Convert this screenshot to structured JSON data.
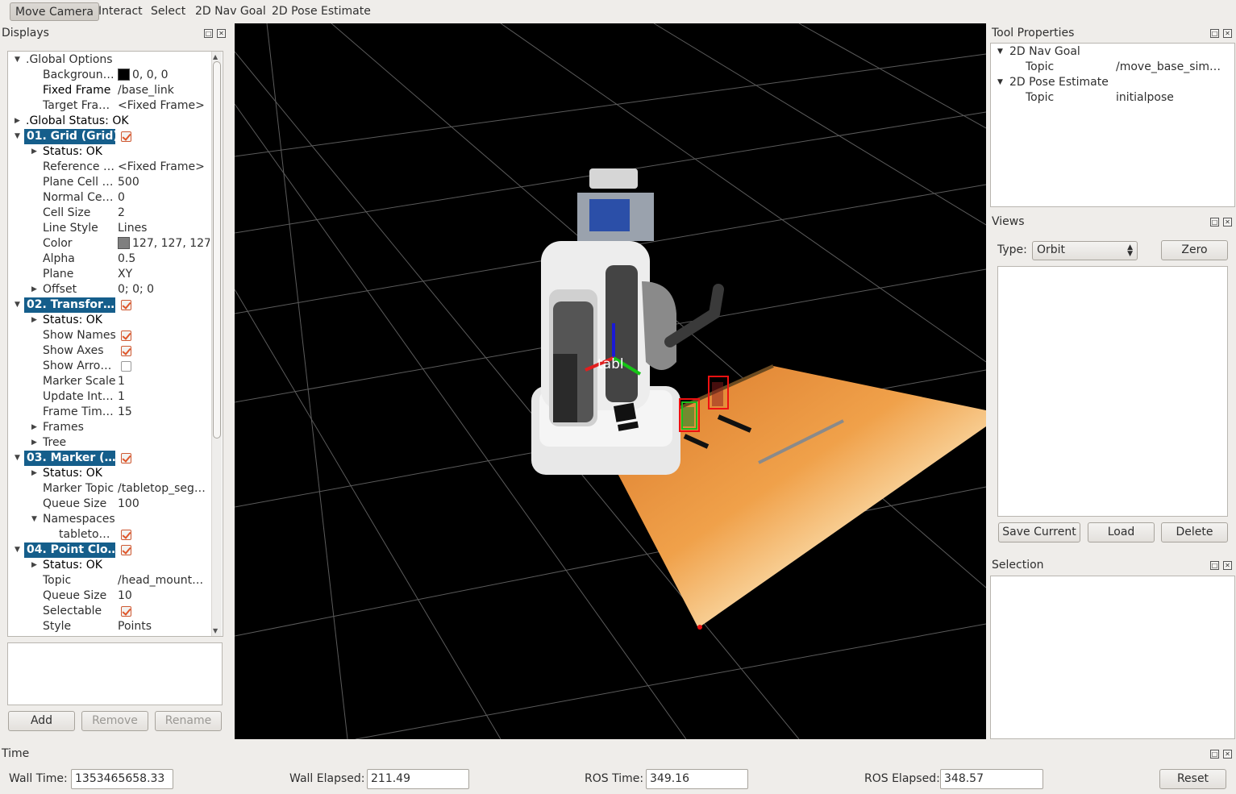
{
  "toolbar": {
    "tools": [
      {
        "label": "Move Camera",
        "active": true
      },
      {
        "label": "Interact",
        "active": false
      },
      {
        "label": "Select",
        "active": false
      },
      {
        "label": "2D Nav Goal",
        "active": false
      },
      {
        "label": "2D Pose Estimate",
        "active": false
      }
    ]
  },
  "displays": {
    "title": "Displays",
    "tree": {
      "global_options": ".Global Options",
      "background_label": "Backgroun…",
      "background_value": "0, 0, 0",
      "background_color": "#000000",
      "fixed_frame_label": "Fixed Frame",
      "fixed_frame_value": "/base_link",
      "target_frame_label": "Target Fra…",
      "target_frame_value": "<Fixed Frame>",
      "global_status": ".Global Status: OK",
      "grid": {
        "label": "01. Grid (Grid)",
        "status": "Status: OK",
        "reference_label": "Reference …",
        "reference_value": "<Fixed Frame>",
        "plane_cell_label": "Plane Cell …",
        "plane_cell_value": "500",
        "normal_label": "Normal Ce…",
        "normal_value": "0",
        "cell_size_label": "Cell Size",
        "cell_size_value": "2",
        "line_style_label": "Line Style",
        "line_style_value": "Lines",
        "color_label": "Color",
        "color_value": "127, 127, 127",
        "color_swatch": "#7f7f7f",
        "alpha_label": "Alpha",
        "alpha_value": "0.5",
        "plane_label": "Plane",
        "plane_value": "XY",
        "offset_label": "Offset",
        "offset_value": "0; 0; 0"
      },
      "tf": {
        "label": "02. Transfor…",
        "status": "Status: OK",
        "show_names_label": "Show Names",
        "show_axes_label": "Show Axes",
        "show_arrows_label": "Show Arro…",
        "marker_scale_label": "Marker Scale",
        "marker_scale_value": "1",
        "update_label": "Update Int…",
        "update_value": "1",
        "frame_time_label": "Frame Tim…",
        "frame_time_value": "15",
        "frames_label": "Frames",
        "tree_label": "Tree"
      },
      "marker": {
        "label": "03. Marker (…",
        "status": "Status: OK",
        "topic_label": "Marker Topic",
        "topic_value": "/tabletop_seg…",
        "queue_label": "Queue Size",
        "queue_value": "100",
        "namespaces_label": "Namespaces",
        "namespace_item": "tableto…"
      },
      "pointcloud": {
        "label": "04. Point Clo…",
        "status": "Status: OK",
        "topic_label": "Topic",
        "topic_value": "/head_mount…",
        "queue_label": "Queue Size",
        "queue_value": "10",
        "selectable_label": "Selectable",
        "style_label": "Style",
        "style_value": "Points"
      }
    },
    "buttons": {
      "add": "Add",
      "remove": "Remove",
      "rename": "Rename"
    }
  },
  "viewport": {
    "frame_label": "tabl"
  },
  "tool_properties": {
    "title": "Tool Properties",
    "nav_goal": "2D Nav Goal",
    "nav_topic_label": "Topic",
    "nav_topic_value": "/move_base_sim…",
    "pose_estimate": "2D Pose Estimate",
    "pose_topic_label": "Topic",
    "pose_topic_value": "initialpose"
  },
  "views": {
    "title": "Views",
    "type_label": "Type:",
    "type_value": "Orbit",
    "zero_button": "Zero",
    "save_button": "Save Current",
    "load_button": "Load",
    "delete_button": "Delete"
  },
  "selection": {
    "title": "Selection"
  },
  "time": {
    "title": "Time",
    "wall_time_label": "Wall Time:",
    "wall_time_value": "1353465658.33",
    "wall_elapsed_label": "Wall Elapsed:",
    "wall_elapsed_value": "211.49",
    "ros_time_label": "ROS Time:",
    "ros_time_value": "349.16",
    "ros_elapsed_label": "ROS Elapsed:",
    "ros_elapsed_value": "348.57",
    "reset_button": "Reset"
  }
}
